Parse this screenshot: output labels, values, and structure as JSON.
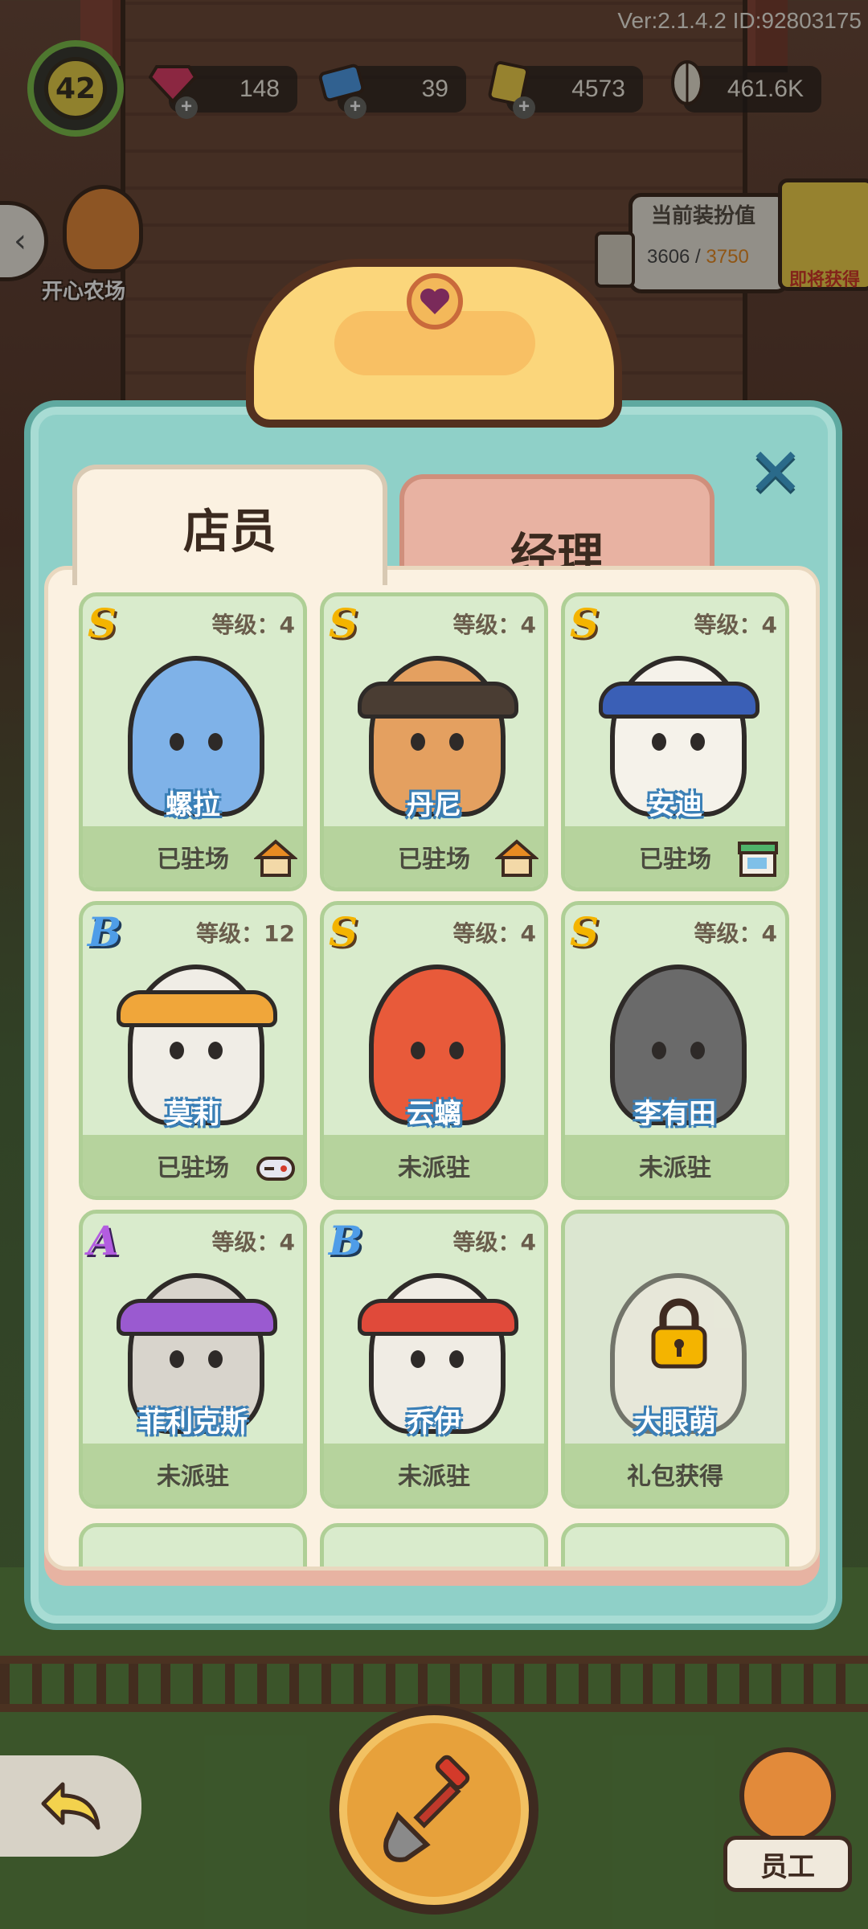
{
  "version": "Ver:2.1.4.2 ID:92803175",
  "player_level": "42",
  "resources": [
    {
      "icon": "gem-icon",
      "value": "148"
    },
    {
      "icon": "ticket-icon",
      "value": "39"
    },
    {
      "icon": "coupon-icon",
      "value": "4573"
    },
    {
      "icon": "sunflower-seed-icon",
      "value": "461.6K"
    }
  ],
  "farm_link": "开心农场",
  "decoration": {
    "title": "当前装扮值",
    "current": "3606",
    "separator": " / ",
    "max": "3750",
    "coming_soon": "即将获得"
  },
  "tabs": {
    "staff": "店员",
    "manager": "经理"
  },
  "staff": [
    {
      "grade": "S",
      "level": "等级：4",
      "name": "螺拉",
      "status": "已驻场",
      "location_icon": "house-icon"
    },
    {
      "grade": "S",
      "level": "等级：4",
      "name": "丹尼",
      "status": "已驻场",
      "location_icon": "house-icon"
    },
    {
      "grade": "S",
      "level": "等级：4",
      "name": "安迪",
      "status": "已驻场",
      "location_icon": "store-icon"
    },
    {
      "grade": "B",
      "level": "等级：12",
      "name": "莫莉",
      "status": "已驻场",
      "location_icon": "gamepad-icon"
    },
    {
      "grade": "S",
      "level": "等级：4",
      "name": "云螭",
      "status": "未派驻",
      "location_icon": ""
    },
    {
      "grade": "S",
      "level": "等级：4",
      "name": "李有田",
      "status": "未派驻",
      "location_icon": ""
    },
    {
      "grade": "A",
      "level": "等级：4",
      "name": "菲利克斯",
      "status": "未派驻",
      "location_icon": ""
    },
    {
      "grade": "B",
      "level": "等级：4",
      "name": "乔伊",
      "status": "未派驻",
      "location_icon": ""
    },
    {
      "grade": "",
      "level": "",
      "name": "大眼萌",
      "status": "礼包获得",
      "location_icon": "",
      "locked": true
    }
  ],
  "bottom": {
    "staff_button": "员工"
  },
  "colors": {
    "modal_bg": "#8fd0c8",
    "card_bg": "#d9ebcc",
    "grade_S": "#f4b400",
    "grade_A": "#b35de0",
    "grade_B": "#4f9de8",
    "decoration_max": "#e88b23"
  }
}
